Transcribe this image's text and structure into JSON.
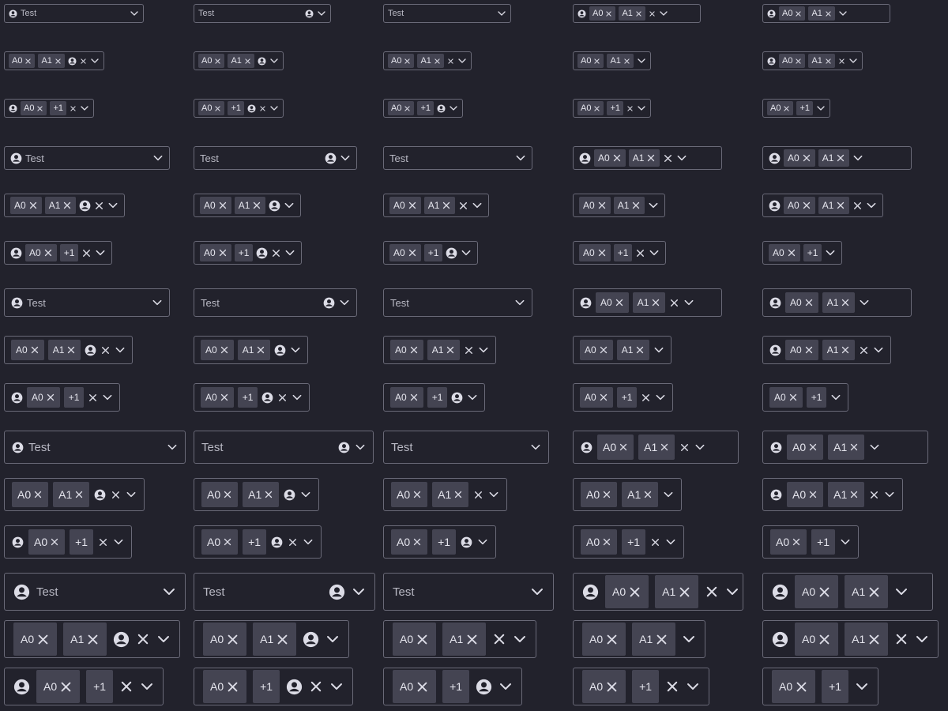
{
  "placeholder": "Test",
  "chip_a0": "A0",
  "chip_a1": "A1",
  "chip_more": "+1",
  "grid": {
    "columns": [
      {
        "variant": "leading-icon, clearable"
      },
      {
        "variant": "trailing-icon"
      },
      {
        "variant": "no-icon, clearable"
      },
      {
        "variant": "leading-icon, clearable, fit-content"
      },
      {
        "variant": "leading-icon, fit-content"
      }
    ]
  },
  "icons": {
    "avatar": "account-circle-icon",
    "clear": "close-icon",
    "remove_chip": "close-icon",
    "dropdown": "chevron-down-icon"
  },
  "colors": {
    "background": "#22222c",
    "border": "#6a6a78",
    "chip": "#444452",
    "text": "#dcdce6"
  }
}
